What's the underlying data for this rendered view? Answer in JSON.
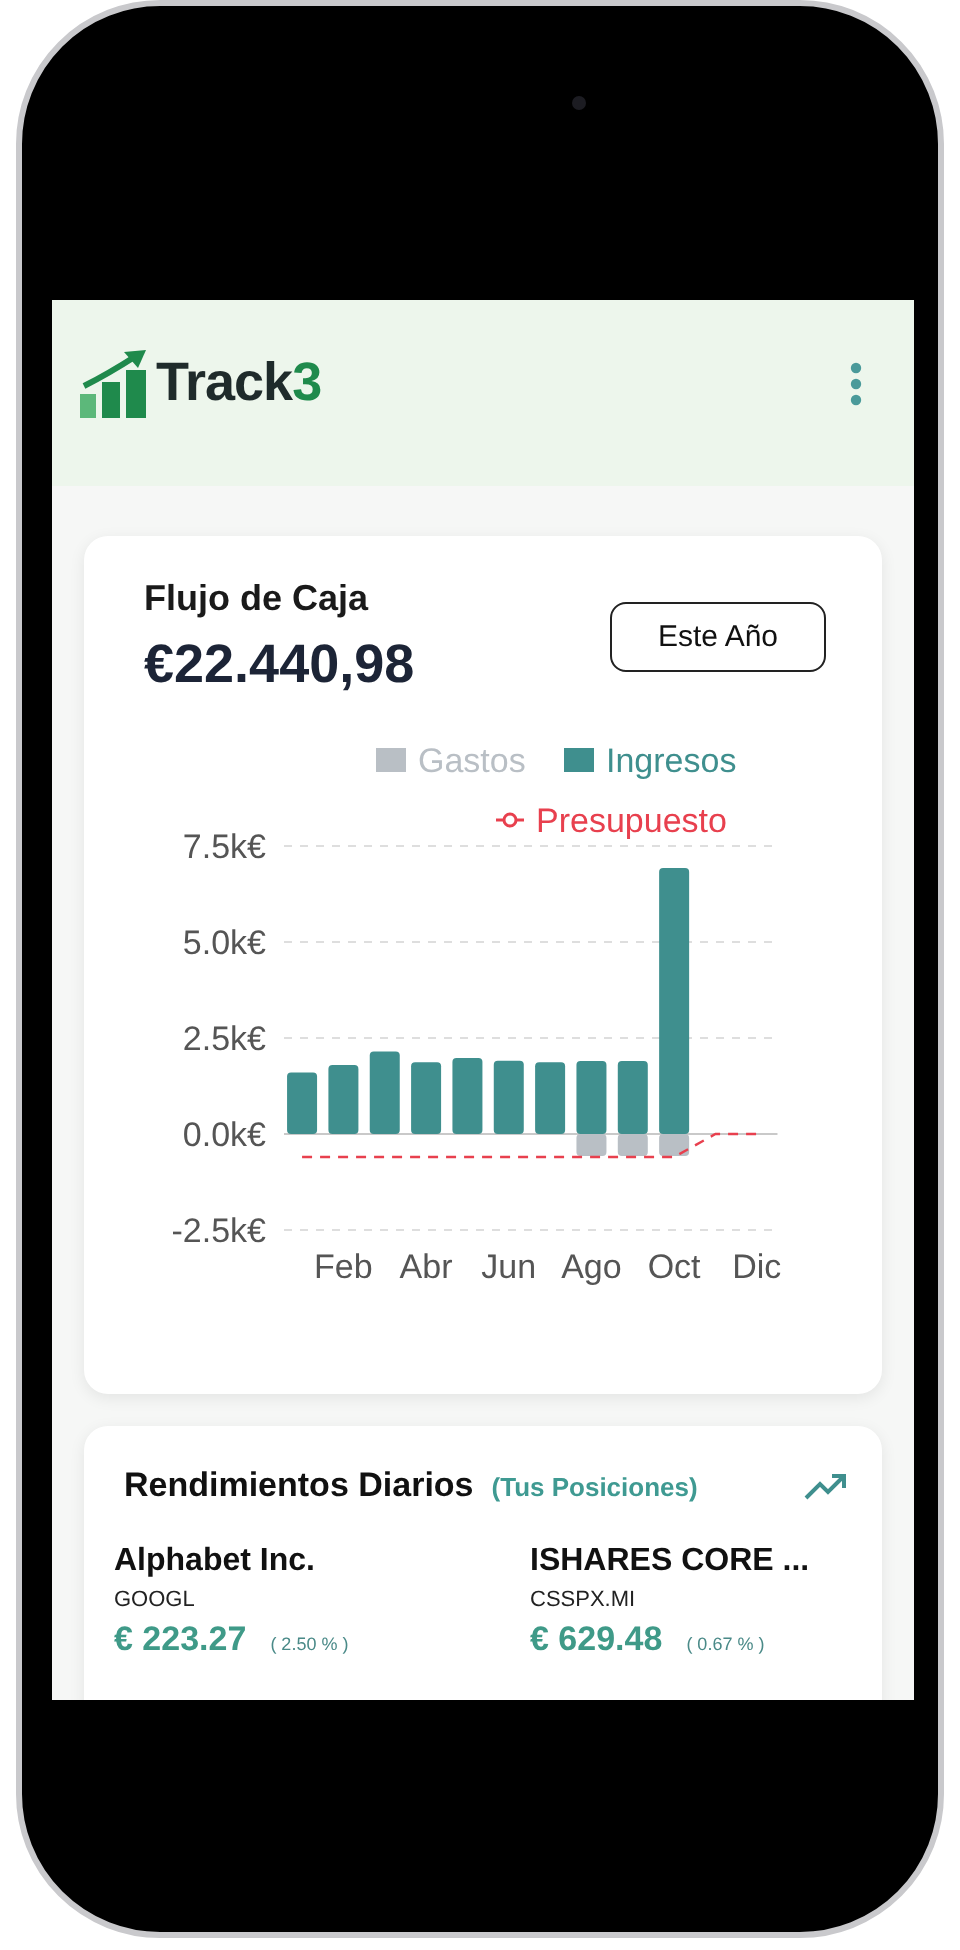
{
  "header": {
    "brand": "Track",
    "brand_accent": "3"
  },
  "cash_flow": {
    "title": "Flujo de Caja",
    "amount": "€22.440,98",
    "period_button": "Este Año",
    "chart_data": {
      "type": "bar",
      "categories": [
        null,
        "Feb",
        null,
        "Abr",
        null,
        "Jun",
        null,
        "Ago",
        null,
        "Oct",
        null,
        "Dic"
      ],
      "series": [
        {
          "name": "Gastos",
          "color": "#b9bfc5",
          "type": "bar",
          "values": [
            0,
            0,
            0,
            0,
            0,
            0,
            0,
            -0.57,
            -0.57,
            -0.57,
            null,
            null
          ]
        },
        {
          "name": "Ingresos",
          "color": "#3f8f8e",
          "type": "bar",
          "values": [
            1.6,
            1.8,
            2.15,
            1.87,
            1.98,
            1.91,
            1.87,
            1.9,
            1.9,
            6.93,
            null,
            null
          ]
        },
        {
          "name": "Presupuesto",
          "color": "#e8404e",
          "type": "line",
          "line_style": "dashed",
          "values": [
            -0.6,
            -0.6,
            -0.6,
            -0.6,
            -0.6,
            -0.6,
            -0.6,
            -0.6,
            -0.6,
            -0.6,
            0,
            0
          ]
        }
      ],
      "legend": "top-right",
      "ylim": [
        -2.5,
        7.5
      ],
      "yticks": [
        {
          "value": 7.5,
          "label": "7.5k€"
        },
        {
          "value": 5,
          "label": "5.0k€"
        },
        {
          "value": 2.5,
          "label": "2.5k€"
        },
        {
          "value": 0,
          "label": "0.0k€"
        },
        {
          "value": -2.5,
          "label": "-2.5k€"
        }
      ],
      "stacked": true
    }
  },
  "daily_returns": {
    "title": "Rendimientos Diarios",
    "subtitle": "(Tus Posiciones)",
    "positions": [
      {
        "name": "Alphabet Inc.",
        "ticker": "GOOGL",
        "price": "€ 223.27",
        "change": "( 2.50 % )"
      },
      {
        "name": "ISHARES CORE ...",
        "ticker": "CSSPX.MI",
        "price": "€ 629.48",
        "change": "( 0.67 % )"
      }
    ]
  }
}
